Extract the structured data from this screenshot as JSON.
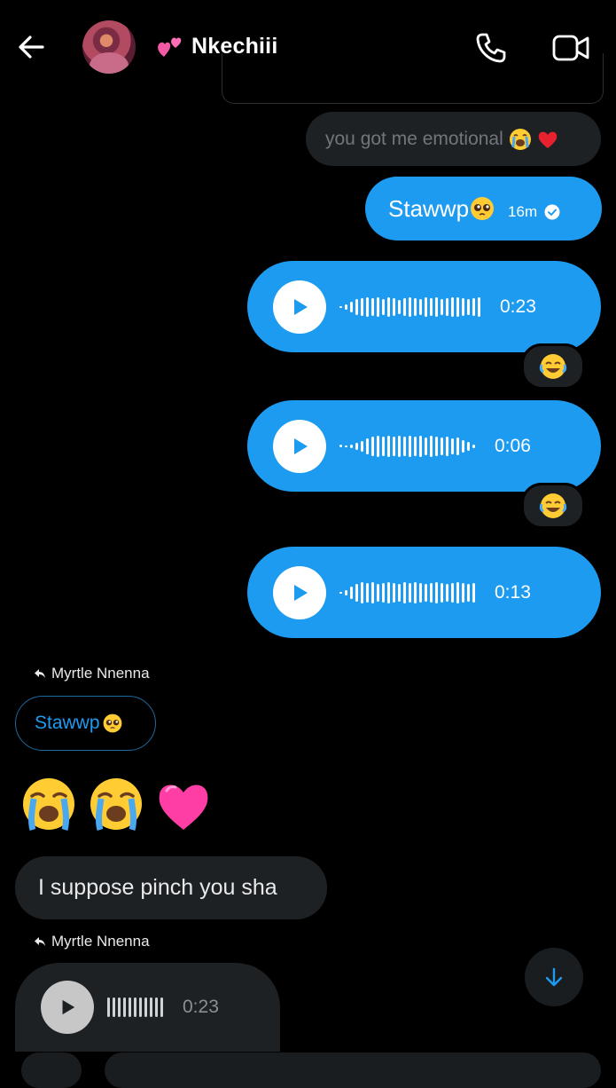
{
  "header": {
    "title": "Nkechiii",
    "title_emoji_icon": "two-hearts-icon",
    "back_icon": "arrow-left-icon",
    "call_icon": "phone-icon",
    "video_icon": "video-camera-icon"
  },
  "colors": {
    "accent": "#1d9bf0",
    "bubble_dark": "#1e2124",
    "background": "#000000",
    "muted_text": "#71767b"
  },
  "messages": {
    "quoted_grey": {
      "text": "you got me emotional",
      "emojis": [
        "loudly-crying-face-icon",
        "red-heart-icon"
      ]
    },
    "sent_text": {
      "text": "Stawwp",
      "emoji": "pleading-face-icon",
      "time": "16m",
      "status_icon": "check-circle-icon"
    },
    "voice_1": {
      "duration": "0:23",
      "reaction": "face-with-tears-of-joy-icon"
    },
    "voice_2": {
      "duration": "0:06",
      "reaction": "face-with-tears-of-joy-icon"
    },
    "voice_3": {
      "duration": "0:13"
    },
    "reply_1": {
      "label": "Myrtle Nnenna",
      "icon": "reply-arrow-icon"
    },
    "quoted_reply": {
      "text": "Stawwp",
      "emoji": "pleading-face-icon"
    },
    "emoji_message": [
      "loudly-crying-face-icon",
      "loudly-crying-face-icon",
      "pink-heart-icon"
    ],
    "incoming_text": "I suppose pinch you sha",
    "reply_2": {
      "label": "Myrtle Nnenna",
      "icon": "reply-arrow-icon"
    },
    "incoming_voice": {
      "duration": "0:23"
    }
  },
  "scroll_button": {
    "icon": "arrow-down-icon"
  }
}
